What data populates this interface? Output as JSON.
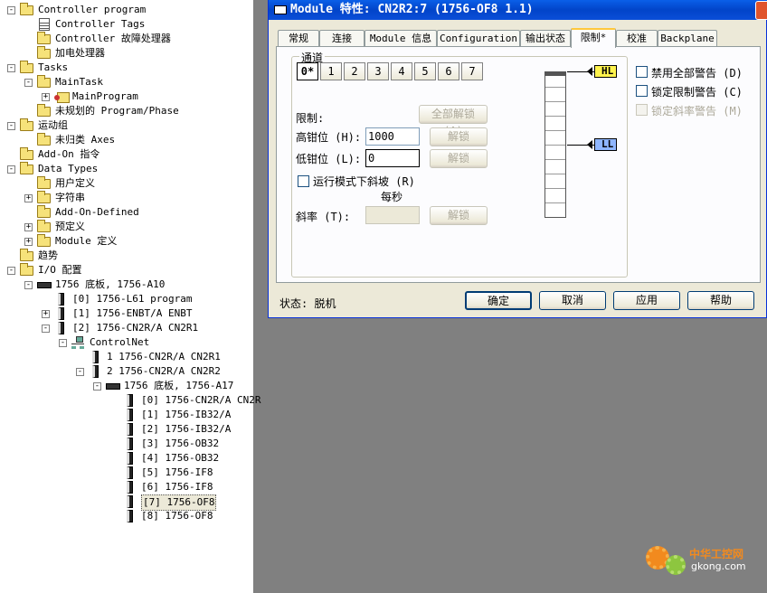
{
  "tree": [
    {
      "label": "Controller program",
      "icon": "folder-icon",
      "depth": 0,
      "expand": "-"
    },
    {
      "label": "Controller Tags",
      "icon": "tag-icon",
      "depth": 1
    },
    {
      "label": "Controller 故障处理器",
      "icon": "folder-icon",
      "depth": 1
    },
    {
      "label": "加电处理器",
      "icon": "folder-icon",
      "depth": 1
    },
    {
      "label": "Tasks",
      "icon": "folder-icon",
      "depth": 0,
      "expand": "-"
    },
    {
      "label": "MainTask",
      "icon": "task-icon",
      "depth": 1,
      "expand": "-"
    },
    {
      "label": "MainProgram",
      "icon": "program-icon",
      "depth": 2,
      "expand": "+"
    },
    {
      "label": "未规划的 Program/Phase",
      "icon": "folder-icon",
      "depth": 1
    },
    {
      "label": "运动组",
      "icon": "folder-icon",
      "depth": 0,
      "expand": "-"
    },
    {
      "label": "未归类 Axes",
      "icon": "folder-icon",
      "depth": 1
    },
    {
      "label": "Add-On 指令",
      "icon": "folder-icon",
      "depth": 0
    },
    {
      "label": "Data Types",
      "icon": "folder-icon",
      "depth": 0,
      "expand": "-"
    },
    {
      "label": "用户定义",
      "icon": "folder-icon",
      "depth": 1
    },
    {
      "label": "字符串",
      "icon": "folder-icon",
      "depth": 1,
      "expand": "+"
    },
    {
      "label": "Add-On-Defined",
      "icon": "folder-icon",
      "depth": 1
    },
    {
      "label": "预定义",
      "icon": "folder-icon",
      "depth": 1,
      "expand": "+"
    },
    {
      "label": "Module 定义",
      "icon": "folder-icon",
      "depth": 1,
      "expand": "+"
    },
    {
      "label": "趋势",
      "icon": "folder-icon",
      "depth": 0
    },
    {
      "label": "I/O 配置",
      "icon": "folder-icon",
      "depth": 0,
      "expand": "-"
    },
    {
      "label": "1756 底板, 1756-A10",
      "icon": "chassis-icon",
      "depth": 1,
      "expand": "-"
    },
    {
      "label": "[0] 1756-L61 program",
      "icon": "controller-module-icon",
      "depth": 2
    },
    {
      "label": "[1] 1756-ENBT/A ENBT",
      "icon": "module-icon",
      "depth": 2,
      "expand": "+"
    },
    {
      "label": "[2] 1756-CN2R/A CN2R1",
      "icon": "module-icon",
      "depth": 2,
      "expand": "-"
    },
    {
      "label": "ControlNet",
      "icon": "network-icon",
      "depth": 3,
      "expand": "-"
    },
    {
      "label": "1 1756-CN2R/A CN2R1",
      "icon": "module-icon",
      "depth": 4
    },
    {
      "label": "2 1756-CN2R/A CN2R2",
      "icon": "module-icon",
      "depth": 4,
      "expand": "-"
    },
    {
      "label": "1756 底板, 1756-A17",
      "icon": "chassis-icon",
      "depth": 5,
      "expand": "-"
    },
    {
      "label": "[0] 1756-CN2R/A CN2R",
      "icon": "module-icon",
      "depth": 6
    },
    {
      "label": "[1] 1756-IB32/A",
      "icon": "module-icon",
      "depth": 6
    },
    {
      "label": "[2] 1756-IB32/A",
      "icon": "module-icon",
      "depth": 6
    },
    {
      "label": "[3] 1756-OB32",
      "icon": "module-icon",
      "depth": 6
    },
    {
      "label": "[4] 1756-OB32",
      "icon": "module-icon",
      "depth": 6
    },
    {
      "label": "[5] 1756-IF8",
      "icon": "module-icon",
      "depth": 6
    },
    {
      "label": "[6] 1756-IF8",
      "icon": "module-icon",
      "depth": 6
    },
    {
      "label": "[7] 1756-OF8",
      "icon": "module-icon",
      "depth": 6,
      "selected": true
    },
    {
      "label": "[8] 1756-OF8",
      "icon": "module-icon",
      "depth": 6
    }
  ],
  "dialog": {
    "title": "Module 特性: CN2R2:7 (1756-OF8 1.1)",
    "tabs": [
      "常规",
      "连接",
      "Module 信息",
      "Configuration",
      "输出状态",
      "限制*",
      "校准",
      "Backplane"
    ],
    "active_tab": "限制*",
    "channel_group_label": "通道",
    "channels": [
      "0*",
      "1",
      "2",
      "3",
      "4",
      "5",
      "6",
      "7"
    ],
    "limits_label": "限制:",
    "unlock_all": "全部解锁 (A)",
    "high_clamp_label": "高钳位 (H):",
    "high_clamp_value": "1000",
    "low_clamp_label": "低钳位 (L):",
    "low_clamp_value": "0",
    "unlock": "解锁",
    "ramp_label": "运行模式下斜坡 (R)",
    "per_second": "每秒",
    "rate_label": "斜率 (T):",
    "rate_value": "",
    "hl_marker": "HL",
    "ll_marker": "LL",
    "disable_alarms": "禁用全部警告 (D)",
    "latch_limit_alarms": "锁定限制警告 (C)",
    "latch_rate_alarms": "锁定斜率警告 (M)",
    "status_text": "状态: 脱机",
    "ok": "确定",
    "cancel": "取消",
    "apply": "应用",
    "help": "帮助"
  },
  "watermark": {
    "text": "中华工控网",
    "url_text": "gkong.com"
  }
}
